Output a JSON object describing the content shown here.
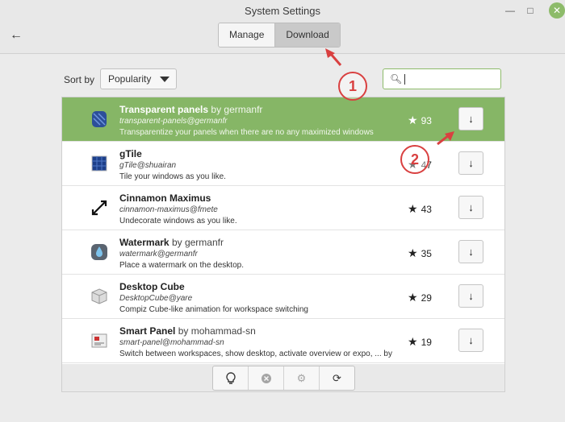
{
  "window": {
    "title": "System Settings",
    "minimize_icon": "minimize-icon",
    "maximize_icon": "maximize-icon",
    "close_icon": "close-icon"
  },
  "nav": {
    "back_icon": "back-arrow-icon"
  },
  "tabs": [
    {
      "label": "Manage",
      "active": false
    },
    {
      "label": "Download",
      "active": true
    }
  ],
  "sort": {
    "label": "Sort by",
    "selected": "Popularity"
  },
  "search": {
    "value": "",
    "icon": "search-icon"
  },
  "applets": [
    {
      "name": "Transparent panels",
      "by": "by germanfr",
      "uuid": "transparent-panels@germanfr",
      "description": "Transparentize your panels when there are no any maximized windows",
      "rating": "93",
      "selected": true
    },
    {
      "name": "gTile",
      "by": "",
      "uuid": "gTile@shuairan",
      "description": "Tile your windows as you like.",
      "rating": "47",
      "selected": false
    },
    {
      "name": "Cinnamon Maximus",
      "by": "",
      "uuid": "cinnamon-maximus@fmete",
      "description": "Undecorate windows as you like.",
      "rating": "43",
      "selected": false
    },
    {
      "name": "Watermark",
      "by": "by germanfr",
      "uuid": "watermark@germanfr",
      "description": "Place a watermark on the desktop.",
      "rating": "35",
      "selected": false
    },
    {
      "name": "Desktop Cube",
      "by": "",
      "uuid": "DesktopCube@yare",
      "description": "Compiz Cube-like animation for workspace switching",
      "rating": "29",
      "selected": false
    },
    {
      "name": "Smart Panel",
      "by": "by mohammad-sn",
      "uuid": "smart-panel@mohammad-sn",
      "description": "Switch between workspaces, show desktop, activate overview or expo, ... by",
      "rating": "19",
      "selected": false
    }
  ],
  "toolbar": {
    "buttons": [
      {
        "icon": "lightbulb-icon",
        "enabled": true
      },
      {
        "icon": "remove-icon",
        "enabled": false
      },
      {
        "icon": "gear-icon",
        "enabled": false
      },
      {
        "icon": "refresh-icon",
        "enabled": true
      }
    ]
  },
  "annotations": [
    {
      "number": "1"
    },
    {
      "number": "2"
    }
  ],
  "colors": {
    "accent": "#86b666",
    "callout": "#d94040"
  }
}
